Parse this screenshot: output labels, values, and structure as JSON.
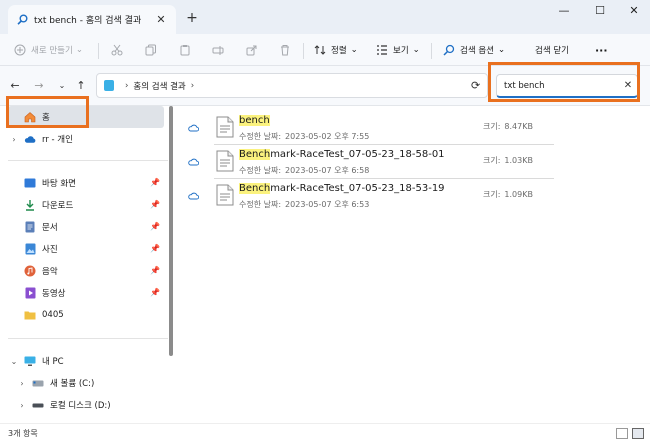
{
  "window": {
    "tab_title": "txt bench - 홈의 검색 결과",
    "new_tab": "+",
    "minimize": "—",
    "maximize": "☐",
    "close": "✕"
  },
  "command_bar": {
    "new_label": "새로 만들기",
    "sort_label": "정렬",
    "view_label": "보기",
    "search_options_label": "검색 옵션",
    "close_search_label": "검색 닫기",
    "more_label": "···"
  },
  "address_bar": {
    "location": "홈의 검색 결과",
    "search_value": "txt bench"
  },
  "sidebar": {
    "home": "홈",
    "cloud": "rr - 개인",
    "quick_access": [
      {
        "label": "바탕 화면",
        "icon": "desktop-icon",
        "color": "#2f7ad8"
      },
      {
        "label": "다운로드",
        "icon": "download-icon",
        "color": "#1f8a4c"
      },
      {
        "label": "문서",
        "icon": "document-icon",
        "color": "#5b7fb8"
      },
      {
        "label": "사진",
        "icon": "pictures-icon",
        "color": "#3b87d6"
      },
      {
        "label": "음악",
        "icon": "music-icon",
        "color": "#e0623a"
      },
      {
        "label": "동영상",
        "icon": "video-icon",
        "color": "#8a4fd0"
      },
      {
        "label": "0405",
        "icon": "folder-icon",
        "color": "#f0c042"
      }
    ],
    "this_pc": "내 PC",
    "drives": [
      {
        "label": "새 볼륨 (C:)"
      },
      {
        "label": "로컬 디스크 (D:)"
      }
    ]
  },
  "results": [
    {
      "highlight": "bench",
      "rest": "",
      "meta_key": "수정한 날짜:",
      "date": "2023-05-02 오후 7:55",
      "size_key": "크기:",
      "size": "8.47KB"
    },
    {
      "highlight": "Bench",
      "rest": "mark-RaceTest_07-05-23_18-58-01",
      "meta_key": "수정한 날짜:",
      "date": "2023-05-07 오후 6:58",
      "size_key": "크기:",
      "size": "1.03KB"
    },
    {
      "highlight": "Bench",
      "rest": "mark-RaceTest_07-05-23_18-53-19",
      "meta_key": "수정한 날짜:",
      "date": "2023-05-07 오후 6:53",
      "size_key": "크기:",
      "size": "1.09KB"
    }
  ],
  "status": {
    "item_count": "3개 항목"
  },
  "colors": {
    "highlight_box": "#e9701f",
    "match_highlight": "#fbf27e",
    "accent": "#1f6fc5"
  }
}
